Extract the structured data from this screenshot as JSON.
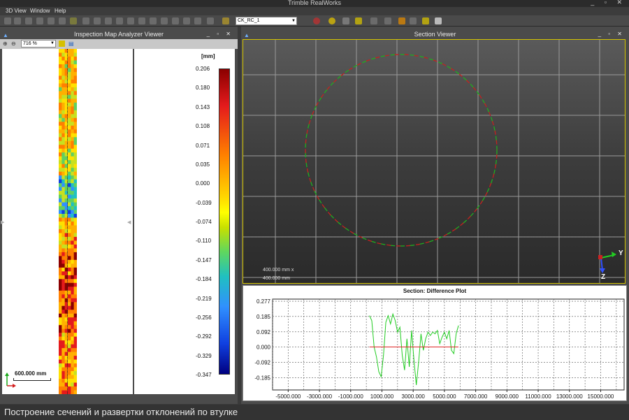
{
  "app": {
    "title": "Trimble RealWorks",
    "window_buttons": "_ ▫ ✕"
  },
  "menu": {
    "items": [
      "3D View",
      "Window",
      "Help"
    ]
  },
  "toolbar": {
    "selected_object": "CK_RC_1"
  },
  "inspection_viewer": {
    "title": "Inspection Map Analyzer Viewer",
    "zoom": "716 %",
    "scale_label": "600.000 mm",
    "legend": {
      "unit": "[mm]",
      "ticks": [
        "0.206",
        "0.180",
        "0.143",
        "0.108",
        "0.071",
        "0.035",
        "0.000",
        "-0.039",
        "-0.074",
        "-0.110",
        "-0.147",
        "-0.184",
        "-0.219",
        "-0.256",
        "-0.292",
        "-0.329",
        "-0.347"
      ]
    }
  },
  "section_viewer": {
    "title": "Section Viewer",
    "scale_x": "400.000 mm x",
    "scale_y": "400.000 mm",
    "axis_y": "Y",
    "axis_z": "Z"
  },
  "difference_plot": {
    "title": "Section: Difference Plot"
  },
  "chart_data": {
    "type": "line",
    "title": "Section: Difference Plot",
    "xlabel": "",
    "ylabel": "",
    "xlim": [
      -6000,
      16500
    ],
    "ylim": [
      -0.26,
      0.29
    ],
    "x_ticks": [
      -5000,
      -3000,
      -1000,
      1000,
      3000,
      5000,
      7000,
      9000,
      11000,
      13000,
      15000
    ],
    "x_tick_labels": [
      "-5000.000",
      "-3000.000",
      "-1000.000",
      "1000.000",
      "3000.000",
      "5000.000",
      "7000.000",
      "9000.000",
      "11000.000",
      "13000.000",
      "15000.000"
    ],
    "y_ticks": [
      0.277,
      0.185,
      0.092,
      0.0,
      -0.092,
      -0.185
    ],
    "y_tick_labels": [
      "0.277",
      "0.185",
      "0.092",
      "0.000",
      "-0.092",
      "-0.185"
    ],
    "grid": true,
    "series": [
      {
        "color": "#22cc22",
        "x": [
          200,
          350,
          500,
          650,
          800,
          950,
          1100,
          1250,
          1400,
          1550,
          1700,
          1850,
          2000,
          2150,
          2300,
          2450,
          2600,
          2750,
          2900,
          3050,
          3200,
          3350,
          3500,
          3650,
          3800,
          3950,
          4100,
          4250,
          4400,
          4550,
          4700,
          4850,
          5000,
          5150,
          5300,
          5450,
          5600,
          5750,
          5900
        ],
        "y": [
          0.19,
          0.16,
          0.0,
          -0.06,
          -0.15,
          -0.18,
          -0.05,
          0.15,
          0.19,
          0.14,
          0.2,
          0.16,
          0.09,
          0.12,
          -0.05,
          -0.14,
          0.05,
          -0.12,
          0.1,
          -0.08,
          -0.23,
          -0.09,
          0.08,
          -0.02,
          0.05,
          0.09,
          0.07,
          0.09,
          0.08,
          0.1,
          0.02,
          0.06,
          0.09,
          0.05,
          0.1,
          -0.02,
          -0.04,
          0.08,
          0.13
        ]
      },
      {
        "color": "#dd2222",
        "x": [
          200,
          5900
        ],
        "y": [
          0.0,
          0.0
        ]
      }
    ]
  },
  "caption": "Построение сечений и развертки отклонений по втулке",
  "colors": {
    "accent_border": "#d4c400",
    "panel_bg": "#4b4b4b"
  }
}
